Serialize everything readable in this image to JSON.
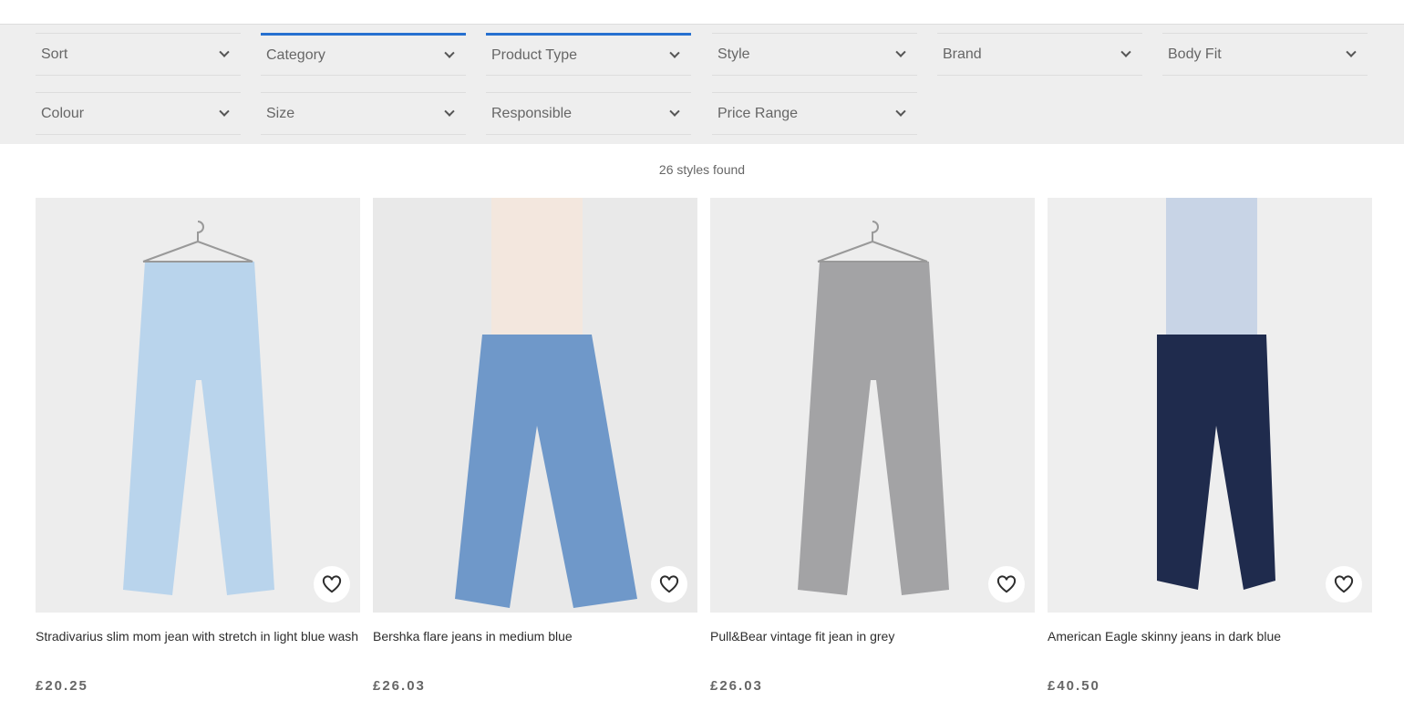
{
  "filters": [
    {
      "label": "Sort",
      "active": false
    },
    {
      "label": "Category",
      "active": true
    },
    {
      "label": "Product Type",
      "active": true
    },
    {
      "label": "Style",
      "active": false
    },
    {
      "label": "Brand",
      "active": false
    },
    {
      "label": "Body Fit",
      "active": false
    },
    {
      "label": "Colour",
      "active": false
    },
    {
      "label": "Size",
      "active": false
    },
    {
      "label": "Responsible",
      "active": false
    },
    {
      "label": "Price Range",
      "active": false
    }
  ],
  "results": {
    "count_text": "26 styles found"
  },
  "products": [
    {
      "name": "Stradivarius slim mom jean with stretch in light blue wash",
      "price": "£20.25",
      "image": "light-blue-mom-jeans-on-hanger",
      "jean_color": "#b9d4ec",
      "bg": "#ededed"
    },
    {
      "name": "Bershka flare jeans in medium blue",
      "price": "£26.03",
      "image": "model-flare-jeans-medium-blue",
      "jean_color": "#6f98c9",
      "bg": "#e9e9e9"
    },
    {
      "name": "Pull&Bear vintage fit jean in grey",
      "price": "£26.03",
      "image": "grey-jeans-on-hanger",
      "jean_color": "#a3a3a5",
      "bg": "#ededed"
    },
    {
      "name": "American Eagle skinny jeans in dark blue",
      "price": "£40.50",
      "image": "model-skinny-jeans-dark-blue",
      "jean_color": "#1f2b4d",
      "bg": "#eeeeee"
    }
  ]
}
